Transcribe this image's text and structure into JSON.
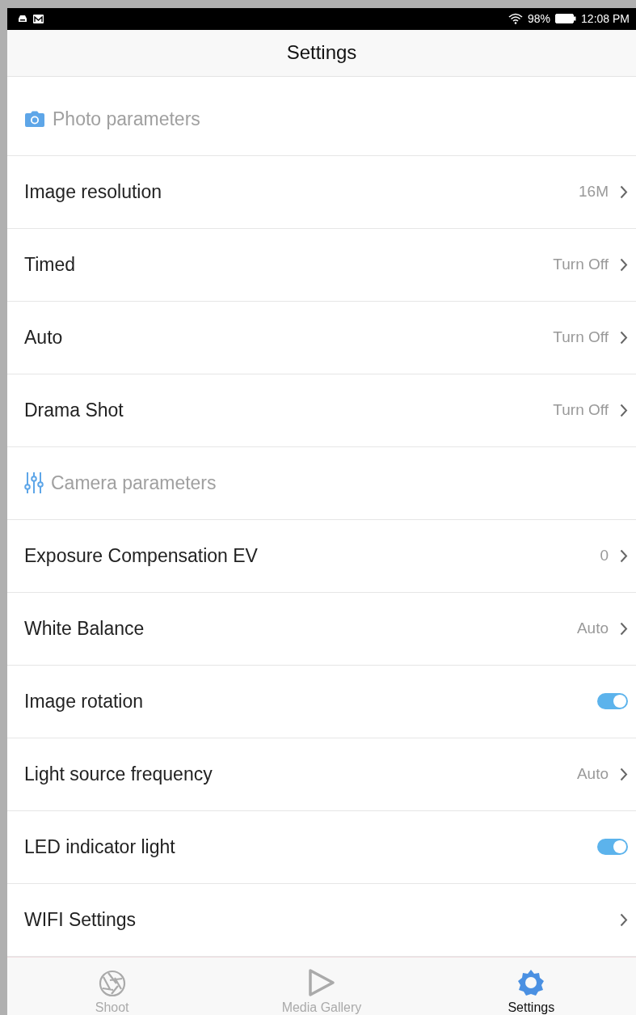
{
  "status_bar": {
    "battery": "98%",
    "time": "12:08 PM"
  },
  "title": "Settings",
  "items": [
    {
      "kind": "section",
      "label": "Photo parameters"
    },
    {
      "kind": "nav",
      "label": "Image resolution",
      "value": "16M"
    },
    {
      "kind": "nav",
      "label": "Timed",
      "value": "Turn Off"
    },
    {
      "kind": "nav",
      "label": "Auto",
      "value": "Turn Off"
    },
    {
      "kind": "nav",
      "label": "Drama Shot",
      "value": "Turn Off"
    },
    {
      "kind": "section",
      "label": "Camera parameters"
    },
    {
      "kind": "nav",
      "label": "Exposure Compensation EV",
      "value": "0"
    },
    {
      "kind": "nav",
      "label": "White Balance",
      "value": "Auto"
    },
    {
      "kind": "toggle",
      "label": "Image rotation",
      "on": true
    },
    {
      "kind": "nav",
      "label": "Light source frequency",
      "value": "Auto"
    },
    {
      "kind": "toggle",
      "label": "LED indicator light",
      "on": true
    },
    {
      "kind": "nav",
      "label": "WIFI Settings"
    }
  ],
  "tabs": [
    {
      "label": "Shoot",
      "selected": false
    },
    {
      "label": "Media Gallery",
      "selected": false
    },
    {
      "label": "Settings",
      "selected": true
    }
  ]
}
